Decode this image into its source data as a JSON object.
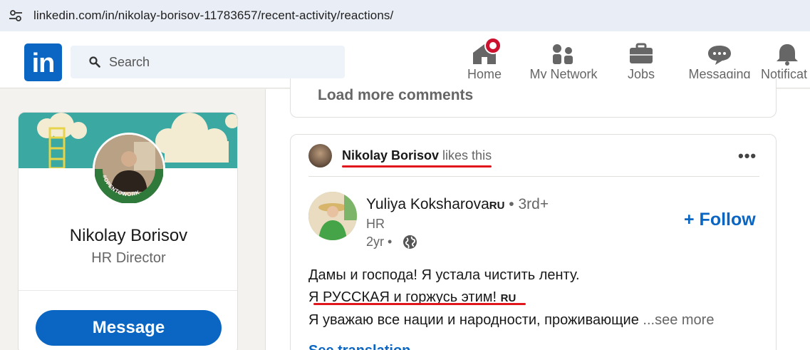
{
  "browser": {
    "url": "linkedin.com/in/nikolay-borisov-11783657/recent-activity/reactions/"
  },
  "nav": {
    "logo": "in",
    "search_placeholder": "Search",
    "items": [
      {
        "label": "Home",
        "icon": "home-icon"
      },
      {
        "label": "My Network",
        "icon": "my-network-icon"
      },
      {
        "label": "Jobs",
        "icon": "briefcase-icon"
      },
      {
        "label": "Messaging",
        "icon": "messaging-icon"
      },
      {
        "label": "Notificat",
        "icon": "bell-icon"
      }
    ]
  },
  "profile": {
    "name": "Nikolay Borisov",
    "title": "HR Director",
    "badge_text": "#OPENTOWORK",
    "message_label": "Message"
  },
  "feed": {
    "load_more": "Load more comments",
    "post": {
      "liker": "Nikolay Borisov",
      "liker_action": " likes this",
      "more_label": "•••",
      "author": "Yuliya Koksharova",
      "author_flag": "RU",
      "degree": " • 3rd+",
      "headline": "HR",
      "time": "2yr •",
      "follow_label": "+ Follow",
      "lines": [
        "Дамы и господа! Я устала чистить ленту.",
        "Я РУССКАЯ и горжусь этим! ",
        "Я уважаю все нации и народности, проживающие "
      ],
      "line2_flag": "RU",
      "see_more": " ...see more",
      "see_translation": "See translation"
    }
  },
  "colors": {
    "brand": "#0a66c2",
    "badge": "#cb112d",
    "annotation_underline": "#e0161c",
    "open_to_work_green": "#2f7a3a"
  }
}
